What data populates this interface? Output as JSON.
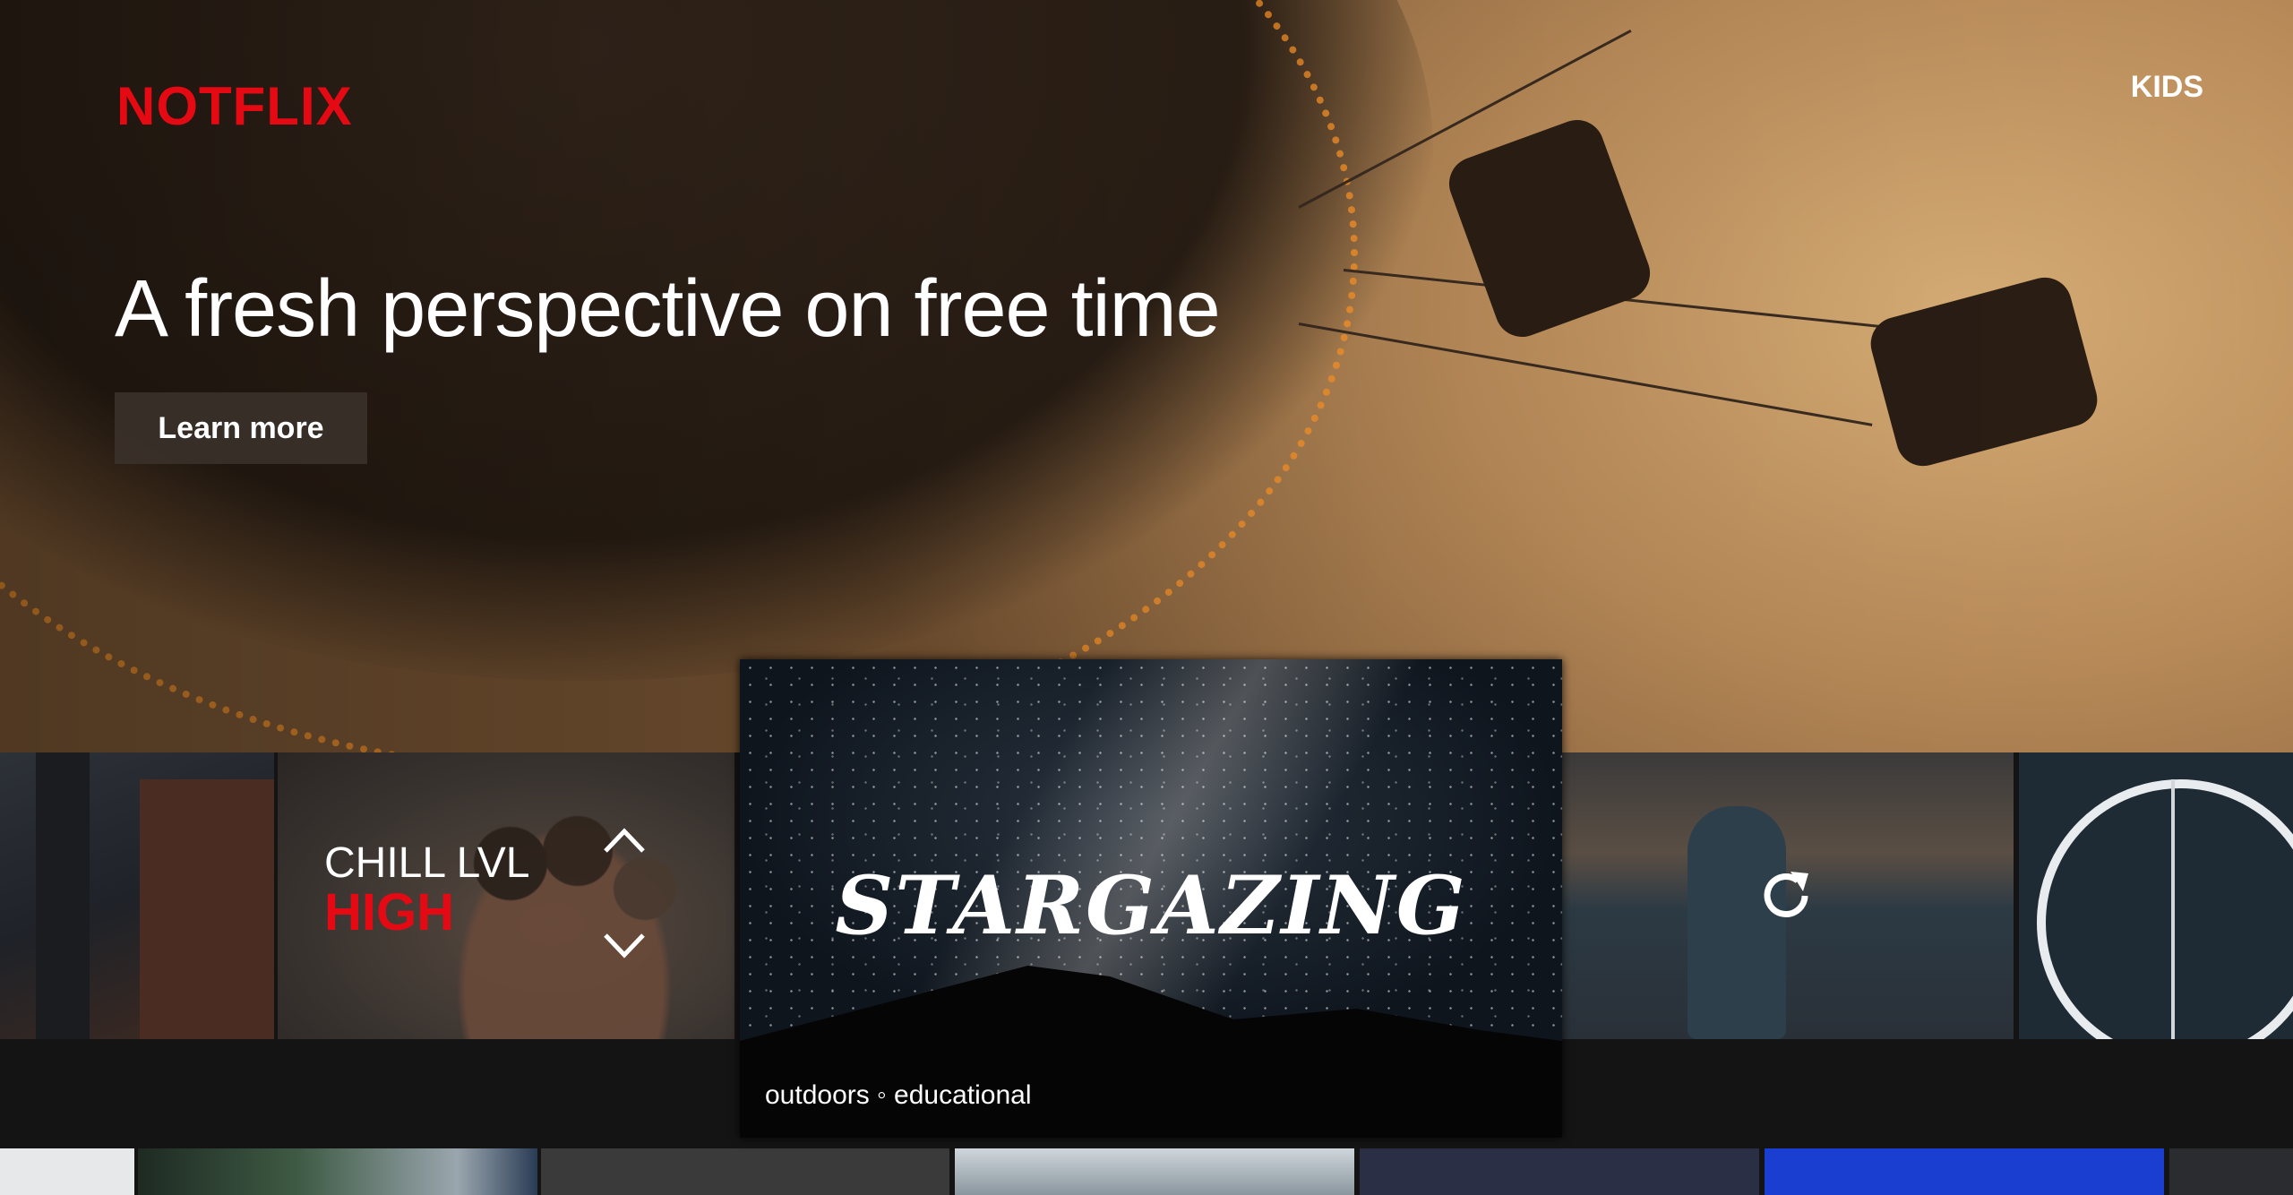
{
  "brand": {
    "name": "NOTFLIX"
  },
  "nav": {
    "kids_label": "KIDS"
  },
  "hero": {
    "title": "A fresh perspective on free time",
    "cta_label": "Learn more"
  },
  "chill": {
    "label": "CHILL LVL",
    "level": "HIGH",
    "up_icon": "chevron-up-icon",
    "down_icon": "chevron-down-icon"
  },
  "featured": {
    "title": "STARGAZING",
    "tags": "outdoors ◦ educational"
  },
  "shuffle": {
    "icon": "refresh-icon"
  },
  "colors": {
    "brand_red": "#e50914",
    "background": "#141414",
    "text": "#ffffff"
  }
}
